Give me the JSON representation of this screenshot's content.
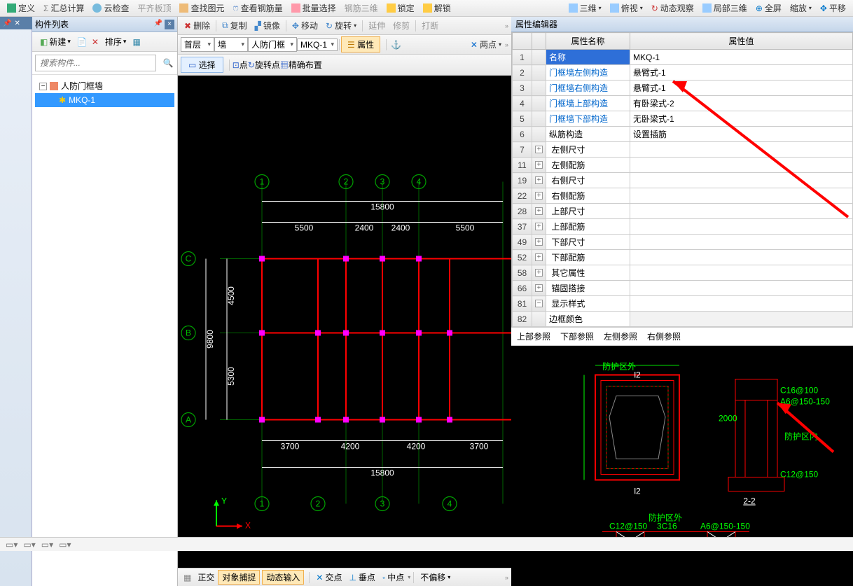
{
  "top_toolbar": {
    "define": "定义",
    "aggregate": "汇总计算",
    "cloud": "云检查",
    "level": "平齐板顶",
    "find": "查找图元",
    "rebar": "查看钢筋量",
    "batch": "批量选择",
    "rebar3d": "钢筋三维",
    "lock": "锁定",
    "unlock": "解锁",
    "view3d": "三维",
    "top": "俯视",
    "dyn": "动态观察",
    "local3d": "局部三维",
    "full": "全屏",
    "zoom": "缩放",
    "pan": "平移"
  },
  "left_panel": {
    "title": "构件列表",
    "new": "新建",
    "sort": "排序",
    "search_placeholder": "搜索构件...",
    "root": "人防门框墙",
    "child": "MKQ-1"
  },
  "edit_bar": {
    "delete": "删除",
    "copy": "复制",
    "mirror": "镜像",
    "move": "移动",
    "rotate": "旋转",
    "extend": "延伸",
    "trim": "修剪",
    "disconnect": "打断"
  },
  "sub_bar": {
    "floor": "首层",
    "cat": "墙",
    "type": "人防门框",
    "name": "MKQ-1",
    "attr": "属性",
    "two_point": "两点"
  },
  "select_bar": {
    "select": "选择",
    "point": "点",
    "rot": "旋转点",
    "accurate": "精确布置"
  },
  "canvas": {
    "grid_cols": [
      "1",
      "2",
      "3",
      "4"
    ],
    "grid_rows": [
      "C",
      "B",
      "A"
    ],
    "top_span": "15800",
    "bottom_span": "15800",
    "top_dims": [
      "5500",
      "2400",
      "2400",
      "5500"
    ],
    "bottom_dims": [
      "3700",
      "4200",
      "4200",
      "3700"
    ],
    "left_span": "9800",
    "left_dims": [
      "4500",
      "5300"
    ],
    "axis_x": "X",
    "axis_y": "Y"
  },
  "canvas_bottom": {
    "ortho": "正交",
    "snap": "对象捕捉",
    "dyn": "动态输入",
    "sep": "",
    "cross": "交点",
    "perp": "垂点",
    "mid": "中点",
    "nooff": "不偏移"
  },
  "prop_panel": {
    "title": "属性编辑器",
    "col_name": "属性名称",
    "col_val": "属性值",
    "rows": [
      {
        "n": "1",
        "name": "名称",
        "val": "MKQ-1",
        "sel": true
      },
      {
        "n": "2",
        "name": "门框墙左侧构造",
        "val": "悬臂式-1",
        "link": true
      },
      {
        "n": "3",
        "name": "门框墙右侧构造",
        "val": "悬臂式-1",
        "link": true
      },
      {
        "n": "4",
        "name": "门框墙上部构造",
        "val": "有卧梁式-2",
        "link": true
      },
      {
        "n": "5",
        "name": "门框墙下部构造",
        "val": "无卧梁式-1",
        "link": true
      },
      {
        "n": "6",
        "name": "纵筋构造",
        "val": "设置插筋"
      },
      {
        "n": "7",
        "name": "左侧尺寸",
        "exp": "+"
      },
      {
        "n": "11",
        "name": "左侧配筋",
        "exp": "+"
      },
      {
        "n": "19",
        "name": "右侧尺寸",
        "exp": "+"
      },
      {
        "n": "22",
        "name": "右侧配筋",
        "exp": "+"
      },
      {
        "n": "28",
        "name": "上部尺寸",
        "exp": "+"
      },
      {
        "n": "37",
        "name": "上部配筋",
        "exp": "+"
      },
      {
        "n": "49",
        "name": "下部尺寸",
        "exp": "+"
      },
      {
        "n": "52",
        "name": "下部配筋",
        "exp": "+"
      },
      {
        "n": "58",
        "name": "其它属性",
        "exp": "+"
      },
      {
        "n": "66",
        "name": "锚固搭接",
        "exp": "+"
      },
      {
        "n": "81",
        "name": "显示样式",
        "exp": "−"
      },
      {
        "n": "82",
        "name": "边框颜色",
        "val": ""
      }
    ]
  },
  "ref_tabs": {
    "top": "上部参照",
    "bottom": "下部参照",
    "left": "左侧参照",
    "right": "右侧参照"
  },
  "detail": {
    "antiprotect": "防护区外",
    "l2": "l2",
    "sec": "2-2",
    "antiprotect_in": "防护区内",
    "rebar1": "3C16",
    "rebar2": "C16@100",
    "rebar3": "C12@150",
    "rebar4": "C12@150",
    "rebar5": "A6@150-150",
    "dim": "2000"
  }
}
